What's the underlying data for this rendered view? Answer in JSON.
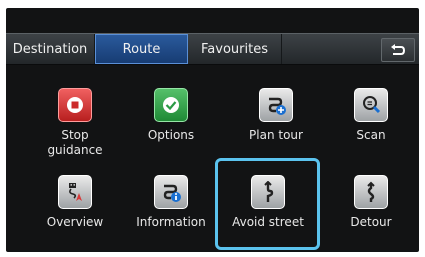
{
  "tabs": [
    {
      "label": "Destination"
    },
    {
      "label": "Route"
    },
    {
      "label": "Favourites"
    }
  ],
  "active_tab": "Route",
  "menu": {
    "stop": "Stop\nguidance",
    "options": "Options",
    "plan_tour": "Plan tour",
    "scan": "Scan",
    "overview": "Overview",
    "information": "Information",
    "avoid_street": "Avoid street",
    "detour": "Detour"
  },
  "selected_item": "Avoid street",
  "colors": {
    "active_tab": "#1f4b8a",
    "selection": "#5bc3ee",
    "stop_icon": "#d83a3a",
    "options_icon": "#2fa249"
  }
}
